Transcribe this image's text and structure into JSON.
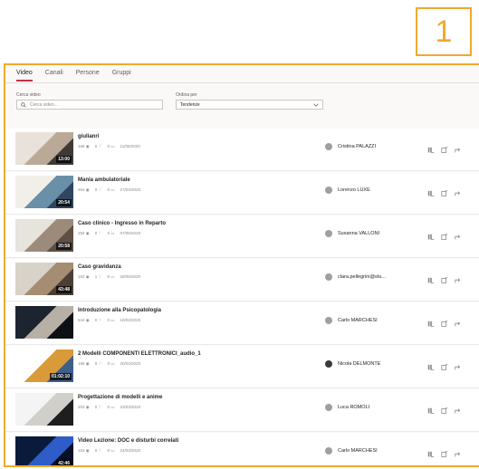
{
  "callout_number": "1",
  "tabs": [
    {
      "label": "Video",
      "active": true
    },
    {
      "label": "Canali",
      "active": false
    },
    {
      "label": "Persone",
      "active": false
    },
    {
      "label": "Gruppi",
      "active": false
    }
  ],
  "search": {
    "label": "Cerca video",
    "placeholder": "Cerca video..."
  },
  "sort": {
    "label": "Ordina per",
    "value": "Tendenze"
  },
  "videos": [
    {
      "title": "giulianri",
      "views": "168",
      "likes": "0",
      "comments": "0",
      "date": "11/05/2020",
      "duration": "13:00",
      "author": "Cristina PALAZZI"
    },
    {
      "title": "Mania ambulatoriale",
      "views": "264",
      "likes": "0",
      "comments": "0",
      "date": "27/04/2020",
      "duration": "20:54",
      "author": "Lorenzo LUXE"
    },
    {
      "title": "Caso clinico - Ingresso in Reparto",
      "views": "284",
      "likes": "0",
      "comments": "0",
      "date": "07/05/2020",
      "duration": "20:58",
      "author": "Susanna VALLONI"
    },
    {
      "title": "Caso gravidanza",
      "views": "182",
      "likes": "1",
      "comments": "0",
      "date": "28/05/2020",
      "duration": "43:48",
      "author": "clara.pellegrini@stu..."
    },
    {
      "title": "Introduzione alla Psicopatologia",
      "views": "644",
      "likes": "0",
      "comments": "0",
      "date": "10/03/2020",
      "duration": "",
      "author": "Carlo MARCHESI"
    },
    {
      "title": "2 Modelli COMPONENTI ELETTRONICI_audio_1",
      "views": "196",
      "likes": "0",
      "comments": "0",
      "date": "20/04/2020",
      "duration": "01:02:10",
      "author": "Nicola DELMONTE"
    },
    {
      "title": "Progettazione di modelli e anime",
      "views": "203",
      "likes": "0",
      "comments": "0",
      "date": "23/03/2020",
      "duration": "",
      "author": "Luca ROMOLI"
    },
    {
      "title": "Video Lezione: DOC e disturbi correlati",
      "views": "153",
      "likes": "0",
      "comments": "0",
      "date": "24/03/2020",
      "duration": "42:46",
      "author": "Carlo MARCHESI"
    }
  ],
  "colors": {
    "accent": "#f0a92f",
    "tab_underline": "#c4314b"
  },
  "icons": [
    "search-icon",
    "chevron-down-icon",
    "eye-icon",
    "heart-icon",
    "comment-icon",
    "add-to-list-icon",
    "watch-later-icon",
    "share-icon"
  ]
}
